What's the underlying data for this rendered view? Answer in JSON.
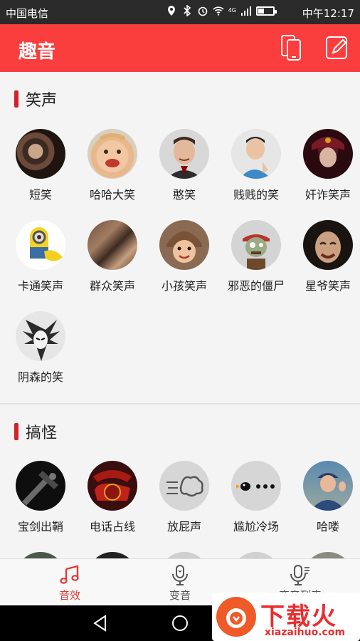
{
  "status_bar": {
    "carrier": "中国电信",
    "network": "4G",
    "time": "中午12:17"
  },
  "app_bar": {
    "title": "趣音",
    "brand_color": "#fa3e3e"
  },
  "sections": [
    {
      "title": "笑声",
      "items": [
        {
          "label": "短笑",
          "icon": "laughing-audience-avatar"
        },
        {
          "label": "哈哈大笑",
          "icon": "laughing-baby-avatar"
        },
        {
          "label": "憨笑",
          "icon": "mr-bean-avatar"
        },
        {
          "label": "贱贱的笑",
          "icon": "smirking-man-avatar"
        },
        {
          "label": "奸诈笑声",
          "icon": "villain-avatar"
        },
        {
          "label": "卡通笑声",
          "icon": "minion-avatar"
        },
        {
          "label": "群众笑声",
          "icon": "crowd-avatar"
        },
        {
          "label": "小孩笑声",
          "icon": "child-aviator-avatar"
        },
        {
          "label": "邪恶的僵尸",
          "icon": "zombie-avatar"
        },
        {
          "label": "星爷笑声",
          "icon": "stephen-chow-avatar"
        },
        {
          "label": "阴森的笑",
          "icon": "creepy-anime-avatar"
        }
      ]
    },
    {
      "title": "搞怪",
      "items": [
        {
          "label": "宝剑出鞘",
          "icon": "sword-avatar"
        },
        {
          "label": "电话占线",
          "icon": "rotary-phone-avatar"
        },
        {
          "label": "放屁声",
          "icon": "fart-cloud-avatar"
        },
        {
          "label": "尴尬冷场",
          "icon": "crow-dots-avatar"
        },
        {
          "label": "哈喽",
          "icon": "waving-man-avatar"
        }
      ]
    }
  ],
  "bottom_nav": [
    {
      "label": "音效",
      "icon": "music-note-icon",
      "active": true
    },
    {
      "label": "变音",
      "icon": "microphone-icon",
      "active": false
    },
    {
      "label": "变音列表",
      "icon": "mic-list-icon",
      "active": false
    }
  ],
  "watermark": {
    "text": "下载火",
    "sub": "xiazaihuo.com"
  },
  "accent_color": "#e53935"
}
